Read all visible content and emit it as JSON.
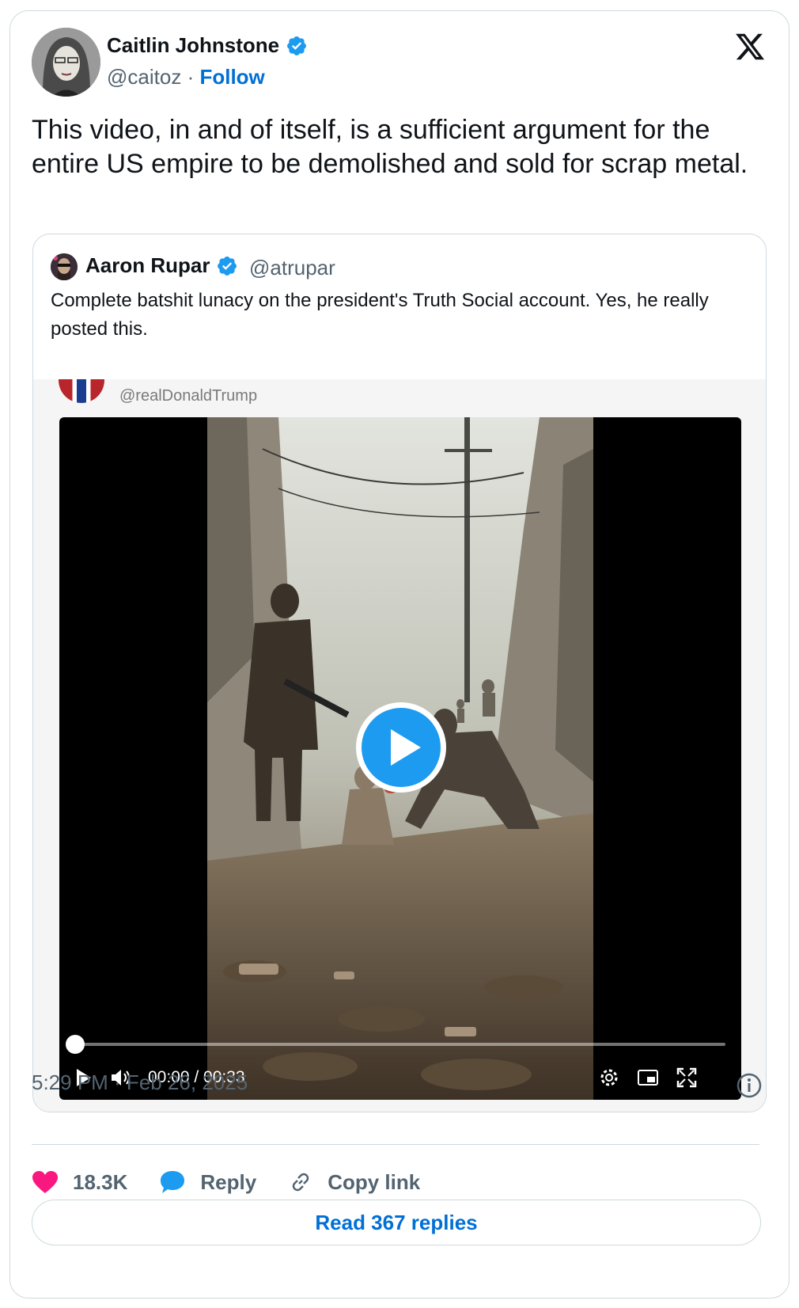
{
  "author": {
    "name": "Caitlin Johnstone",
    "handle": "@caitoz",
    "separator": "·",
    "follow_label": "Follow",
    "avatar_icon": "avatar-portrait"
  },
  "tweet": {
    "text": "This video, in and of itself, is a sufficient argument for the entire US empire to be demolished and sold for scrap metal."
  },
  "quoted_tweet": {
    "author_name": "Aaron Rupar",
    "handle": "@atrupar",
    "text": "Complete batshit lunacy on the president's Truth Social account. Yes, he really posted this.",
    "embedded_handle": "@realDonaldTrump",
    "video": {
      "time_display": "00:00 / 00:33",
      "progress": 0,
      "controls": [
        "play-icon",
        "volume-icon",
        "settings-icon",
        "pip-icon",
        "fullscreen-icon"
      ]
    }
  },
  "meta": {
    "timestamp": "5:29 PM · Feb 26, 2025"
  },
  "actions": {
    "likes": "18.3K",
    "reply_label": "Reply",
    "copy_label": "Copy link"
  },
  "read_replies_label": "Read 367 replies",
  "colors": {
    "link": "#006fd6",
    "verified": "#1d9bf0",
    "like": "#f91880",
    "muted": "#536471"
  }
}
